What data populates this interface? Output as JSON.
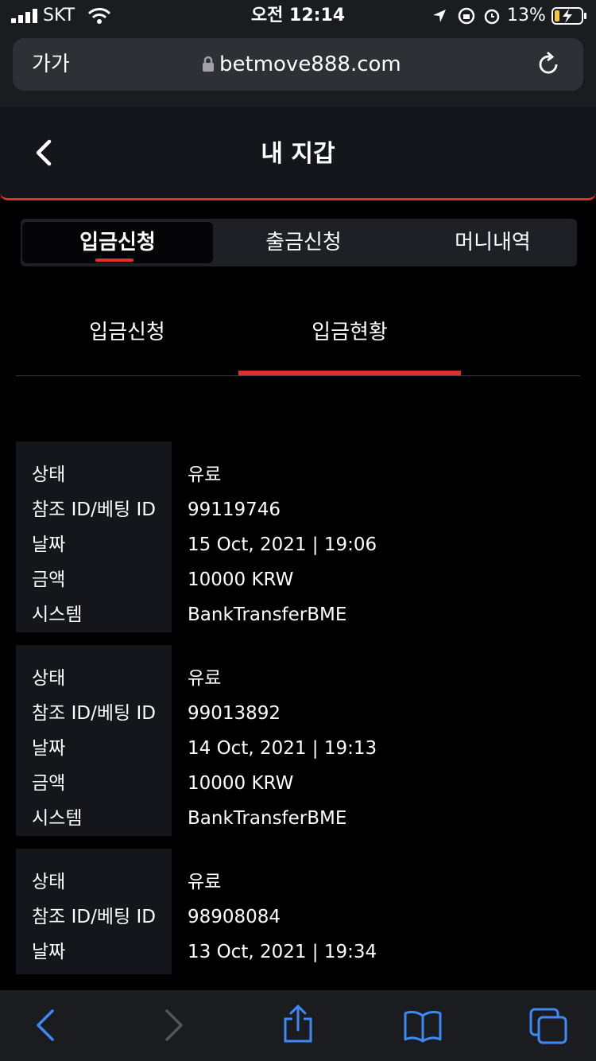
{
  "status_bar": {
    "carrier": "SKT",
    "time": "오전 12:14",
    "battery": "13%"
  },
  "browser": {
    "text_size_label": "가가",
    "url": "betmove888.com",
    "icons": {
      "lock": "lock-icon",
      "reload": "reload-icon"
    }
  },
  "header": {
    "title": "내 지갑",
    "back_icon": "chevron-left-icon"
  },
  "tabs": [
    {
      "label": "입금신청",
      "active": true
    },
    {
      "label": "출금신청",
      "active": false
    },
    {
      "label": "머니내역",
      "active": false
    }
  ],
  "subtabs": [
    {
      "label": "입금신청",
      "active": false
    },
    {
      "label": "입금현황",
      "active": true
    }
  ],
  "accent_color": "#e0302a",
  "deposits": [
    {
      "rows": [
        {
          "label": "상태",
          "value": "유료"
        },
        {
          "label": "참조 ID/베팅 ID",
          "value": "99119746"
        },
        {
          "label": "날짜",
          "value": "15 Oct, 2021 | 19:06"
        },
        {
          "label": "금액",
          "value": "10000 KRW"
        },
        {
          "label": "시스템",
          "value": "BankTransferBME"
        }
      ]
    },
    {
      "rows": [
        {
          "label": "상태",
          "value": "유료"
        },
        {
          "label": "참조 ID/베팅 ID",
          "value": "99013892"
        },
        {
          "label": "날짜",
          "value": "14 Oct, 2021 | 19:13"
        },
        {
          "label": "금액",
          "value": "10000 KRW"
        },
        {
          "label": "시스템",
          "value": "BankTransferBME"
        }
      ]
    },
    {
      "rows": [
        {
          "label": "상태",
          "value": "유료"
        },
        {
          "label": "참조 ID/베팅 ID",
          "value": "98908084"
        },
        {
          "label": "날짜",
          "value": "13 Oct, 2021 | 19:34"
        }
      ]
    }
  ],
  "toolbar_icons": [
    "back-arrow-icon",
    "forward-arrow-icon",
    "share-icon",
    "bookmarks-icon",
    "tabs-icon"
  ]
}
